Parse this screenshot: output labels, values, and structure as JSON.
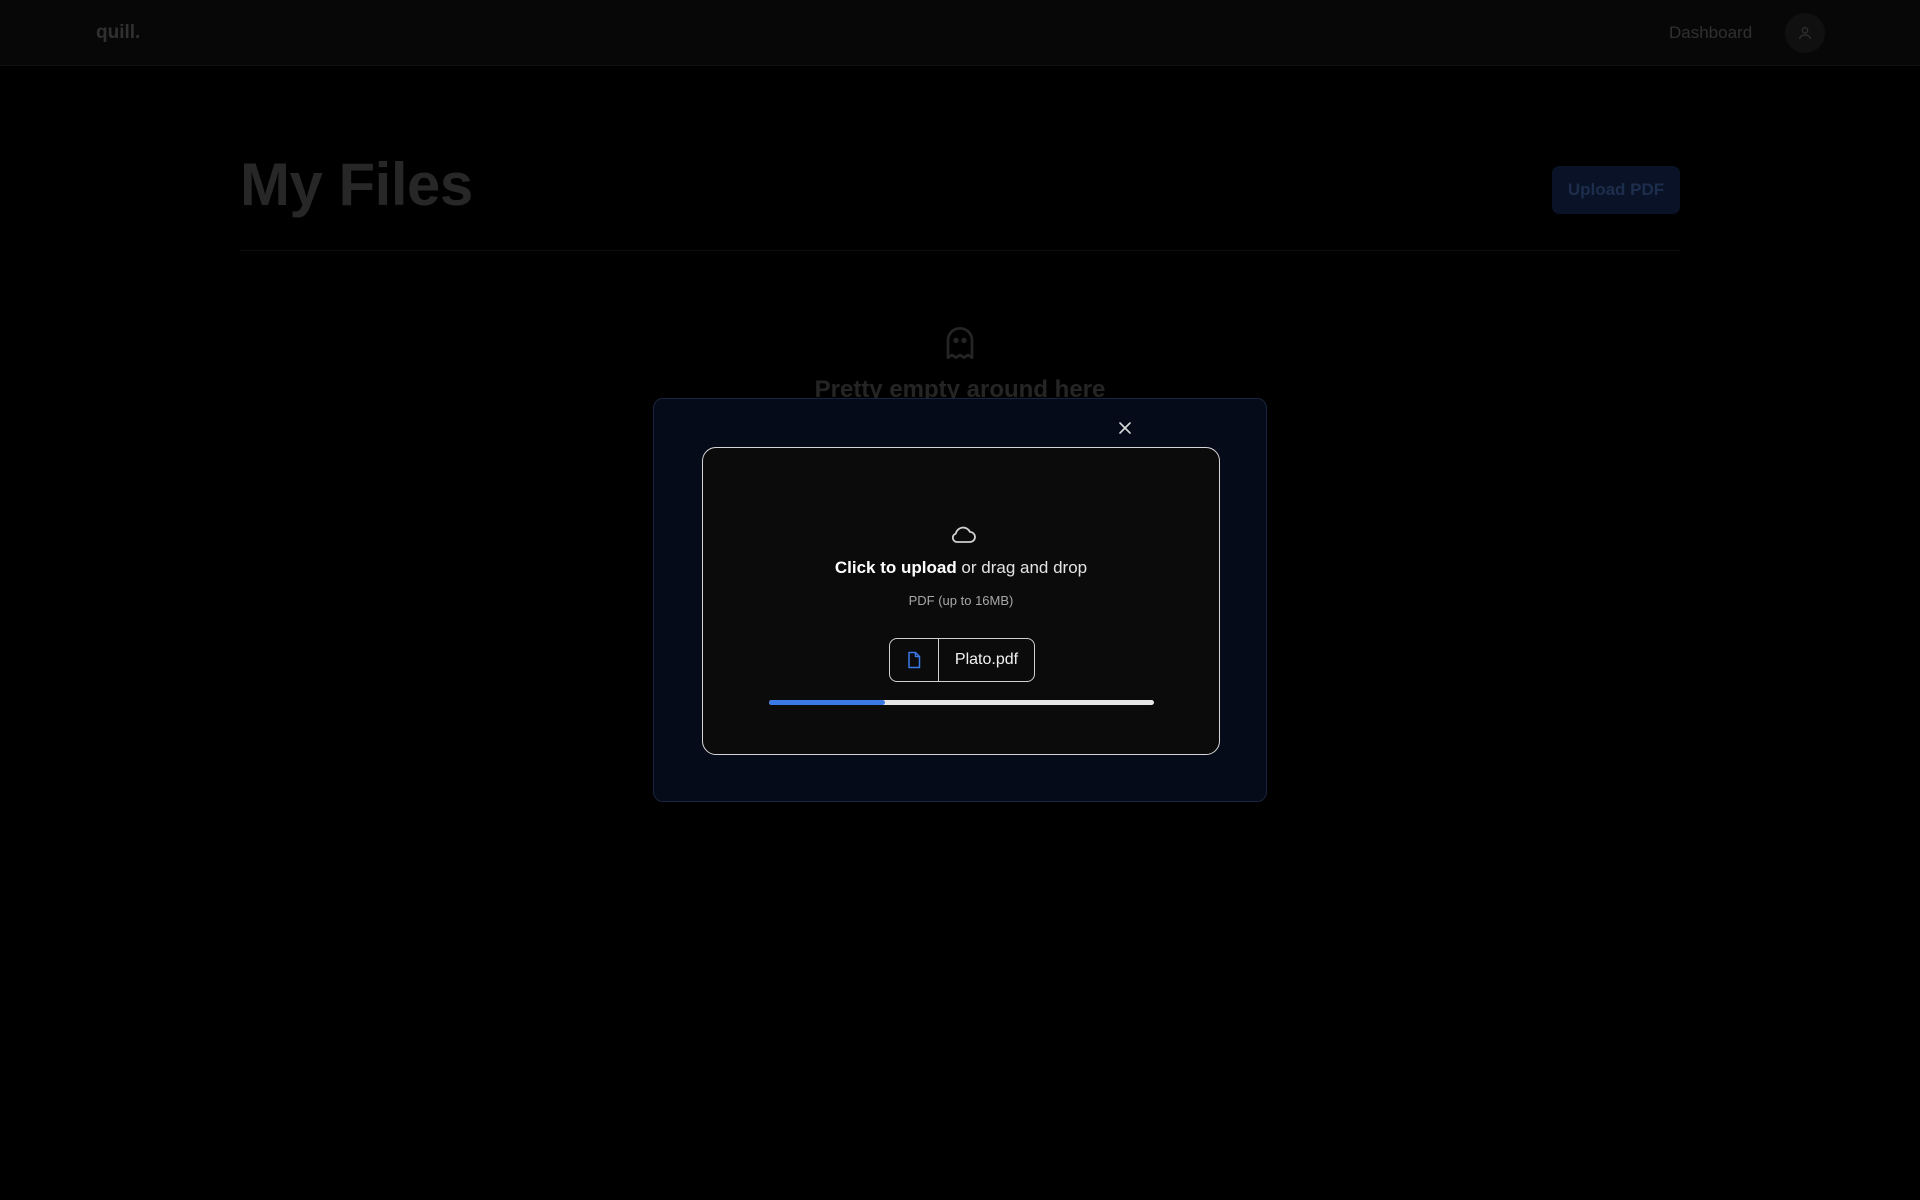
{
  "navbar": {
    "brand": "quill.",
    "links": [
      {
        "label": "Dashboard"
      }
    ]
  },
  "main": {
    "title": "My Files",
    "upload_button": "Upload PDF",
    "empty_state": {
      "title": "Pretty empty around here"
    }
  },
  "modal": {
    "dropzone": {
      "action_strong": "Click to upload",
      "action_rest": " or drag and drop",
      "hint": "PDF (up to 16MB)"
    },
    "file": {
      "name": "Plato.pdf"
    },
    "progress": {
      "fraction": 0.3
    }
  },
  "colors": {
    "accent": "#3b7ae6",
    "modal_bg": "#050b18"
  },
  "icons": [
    "user-icon",
    "ghost-icon",
    "close-icon",
    "cloud-icon",
    "file-icon"
  ]
}
